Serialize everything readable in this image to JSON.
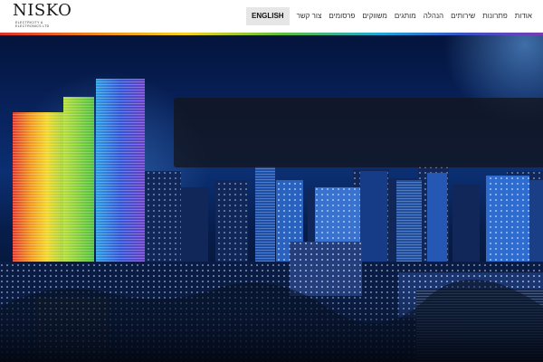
{
  "brand": {
    "name": "NISKO",
    "tagline_line1": "ELECTRICITY &",
    "tagline_line2": "ELECTRONICS LTD"
  },
  "nav": {
    "items": [
      {
        "label": "ENGLISH",
        "active": true
      },
      {
        "label": "צור קשר"
      },
      {
        "label": "פרסומים"
      },
      {
        "label": "משווקים"
      },
      {
        "label": "מותגים"
      },
      {
        "label": "הנהלה"
      },
      {
        "label": "שירותים"
      },
      {
        "label": "פתרונות"
      },
      {
        "label": "אודות"
      }
    ]
  },
  "colors": {
    "accent_rainbow": [
      "#e0302a",
      "#f08a1c",
      "#f5d21e",
      "#5cbf3a",
      "#1fa6d8",
      "#3553c8",
      "#7a3bb5"
    ],
    "hero_sky": "#08235e"
  }
}
